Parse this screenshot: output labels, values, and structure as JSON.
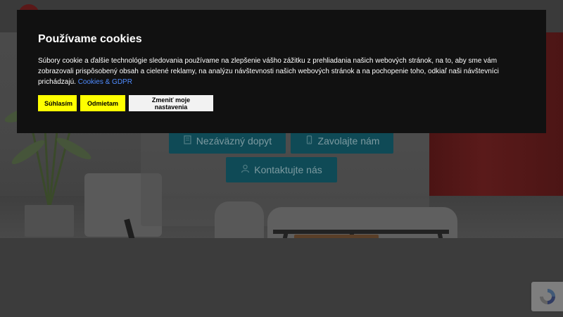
{
  "cookie_banner": {
    "title": "Používame cookies",
    "text": "Súbory cookie a ďalšie technológie sledovania používame na zlepšenie vášho zážitku z prehliadania našich webových stránok, na to, aby sme vám zobrazovali prispôsobený obsah a cielené reklamy, na analýzu návštevnosti našich webových stránok a na pochopenie toho, odkiaľ naši návštevníci prichádzajú.",
    "link_label": "Cookies & GDPR",
    "accept_label": "Súhlasím",
    "reject_label": "Odmietam",
    "settings_label": "Zmeniť moje nastavenia"
  },
  "hero": {
    "buttons": {
      "inquiry_label": "Nezáväzný dopyt",
      "call_label": "Zavolajte nám",
      "contact_label": "Kontaktujte nás"
    }
  },
  "icons": {
    "inquiry": "document-icon",
    "call": "phone-icon",
    "contact": "user-icon",
    "recaptcha": "recaptcha-icon"
  },
  "colors": {
    "banner_bg": "#111111",
    "accept_bg": "#ffff00",
    "link": "#4f8cff",
    "hero_button_bg": "#0f4a56"
  }
}
